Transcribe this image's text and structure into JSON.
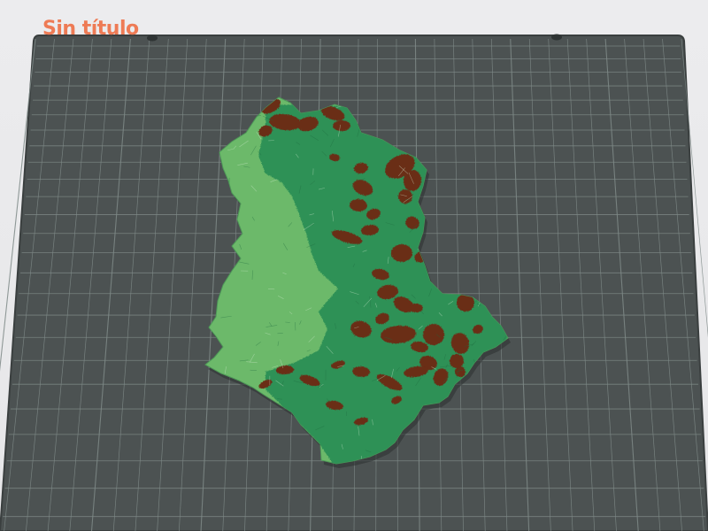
{
  "document": {
    "title": "Sin título"
  },
  "build_plate": {
    "color": "#4c5252",
    "grid_color": "#7f8a88",
    "edge_color": "#3a3f3f"
  },
  "model": {
    "terrain_colors": {
      "lowland": "#6cb96a",
      "forest": "#2e9157",
      "highland": "#6a2d17"
    }
  }
}
